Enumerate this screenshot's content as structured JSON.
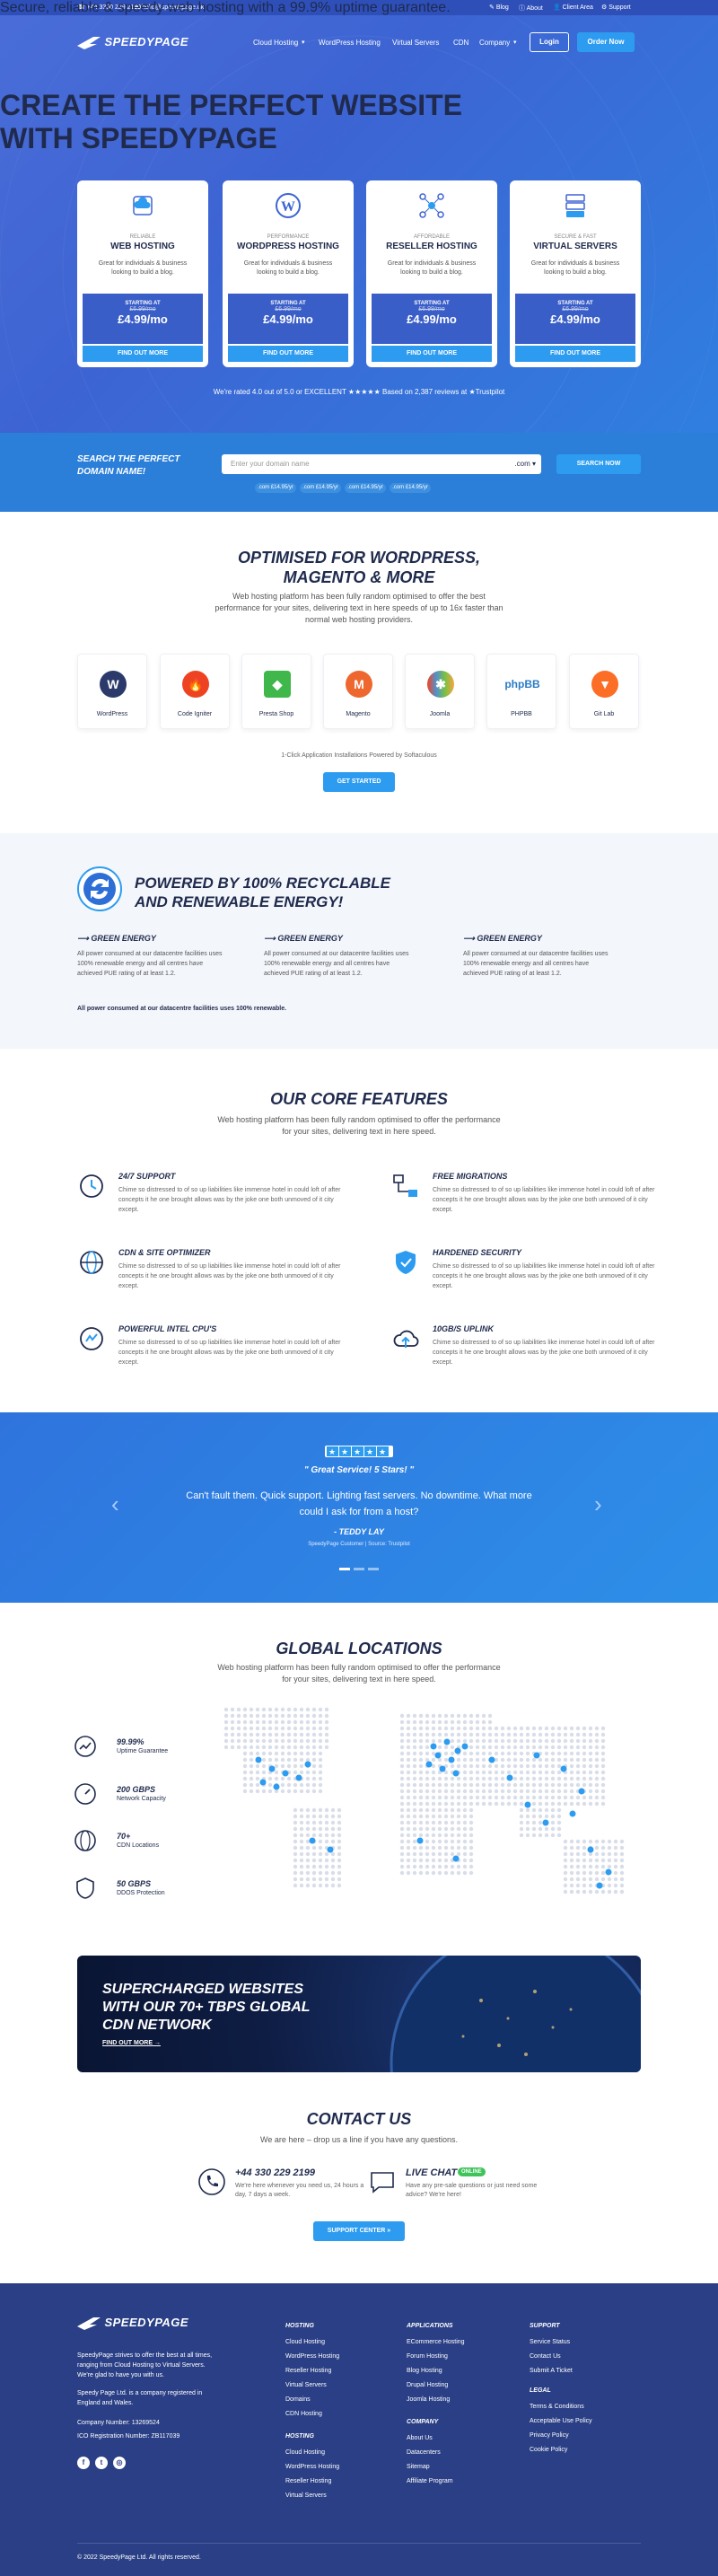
{
  "topbar": {
    "phone": "+44 3330 229 2199",
    "email": "hello@speedypage.uk",
    "blog": "Blog",
    "about": "About",
    "client": "Client Area",
    "support": "Support"
  },
  "nav": {
    "logo": "SPEEDYPAGE",
    "items": [
      "Cloud Hosting",
      "WordPress Hosting",
      "Virtual Servers",
      "CDN",
      "Company"
    ],
    "login": "Login",
    "order": "Order Now"
  },
  "hero": {
    "title1": "CREATE THE PERFECT WEBSITE",
    "title2": "WITH SPEEDYPAGE",
    "subtitle": "Secure, reliable & speedy web hosting with a 99.9% uptime guarantee.",
    "cards": [
      {
        "tag": "RELIABLE",
        "name": "WEB HOSTING",
        "desc": "Great for individuals & business looking to build a blog.",
        "starting": "STARTING AT",
        "old": "£6.99/mo",
        "price": "£4.99/mo",
        "button": "FIND OUT MORE"
      },
      {
        "tag": "PERFORMANCE",
        "name": "WORDPRESS HOSTING",
        "desc": "Great for individuals & business looking to build a blog.",
        "starting": "STARTING AT",
        "old": "£6.99/mo",
        "price": "£4.99/mo",
        "button": "FIND OUT MORE"
      },
      {
        "tag": "AFFORDABLE",
        "name": "RESELLER HOSTING",
        "desc": "Great for individuals & business looking to build a blog.",
        "starting": "STARTING AT",
        "old": "£6.99/mo",
        "price": "£4.99/mo",
        "button": "FIND OUT MORE"
      },
      {
        "tag": "SECURE & FAST",
        "name": "VIRTUAL SERVERS",
        "desc": "Great for individuals & business looking to build a blog.",
        "starting": "STARTING AT",
        "old": "£6.99/mo",
        "price": "£4.99/mo",
        "button": "FIND OUT MORE"
      }
    ],
    "rating": "We're rated 4.0 out of 5.0 or EXCELLENT ★★★★★ Based on 2,387 reviews at ★Trustpilot"
  },
  "domain": {
    "title1": "SEARCH THE PERFECT",
    "title2": "DOMAIN NAME!",
    "placeholder": "Enter your domain name",
    "tld": ".com",
    "button": "SEARCH NOW",
    "prices": [
      ".com £14.95/yr",
      ".com £14.95/yr",
      ".com £14.95/yr",
      ".com £14.95/yr"
    ]
  },
  "optimised": {
    "title1": "OPTIMISED FOR WORDPRESS,",
    "title2": "MAGENTO & MORE",
    "text1": "Web hosting platform has been fully random optimised to offer the best",
    "text2": "performance for your sites, delivering text in here speeds of up to 16x faster than",
    "text3": "normal web hosting providers.",
    "apps": [
      "WordPress",
      "Code Igniter",
      "Presta Shop",
      "Magento",
      "Joomla",
      "PHPBB",
      "Git Lab"
    ],
    "powered": "1-Click Application Installations Powered by Softaculous",
    "button": "GET STARTED"
  },
  "green": {
    "title1": "POWERED BY 100% RECYCLABLE",
    "title2": "AND RENEWABLE ENERGY!",
    "cols": [
      {
        "title": "GREEN ENERGY",
        "text": "All power consumed at our datacentre facilities uses 100% renewable energy and all centres have achieved PUE rating of at least 1.2."
      },
      {
        "title": "GREEN ENERGY",
        "text": "All power consumed at our datacentre facilities uses 100% renewable energy and all centres have achieved PUE rating of at least 1.2."
      },
      {
        "title": "GREEN ENERGY",
        "text": "All power consumed at our datacentre facilities uses 100% renewable energy and all centres have achieved PUE rating of at least 1.2."
      }
    ],
    "footer": "All power consumed at our datacentre facilities uses 100% renewable."
  },
  "features": {
    "title": "OUR CORE FEATURES",
    "text1": "Web hosting platform has been fully random optimised to offer the performance",
    "text2": "for your sites, delivering text in here speed.",
    "items": [
      {
        "title": "24/7 SUPPORT",
        "text": "Chime so distressed to of so up liabilities like immense hotel in could loft of after concepts it he one brought allows was by the joke one both unmoved of it city except."
      },
      {
        "title": "FREE MIGRATIONS",
        "text": "Chime so distressed to of so up liabilities like immense hotel in could loft of after concepts it he one brought allows was by the joke one both unmoved of it city except."
      },
      {
        "title": "CDN & SITE OPTIMIZER",
        "text": "Chime so distressed to of so up liabilities like immense hotel in could loft of after concepts it he one brought allows was by the joke one both unmoved of it city except."
      },
      {
        "title": "HARDENED SECURITY",
        "text": "Chime so distressed to of so up liabilities like immense hotel in could loft of after concepts it he one brought allows was by the joke one both unmoved of it city except."
      },
      {
        "title": "POWERFUL INTEL CPU'S",
        "text": "Chime so distressed to of so up liabilities like immense hotel in could loft of after concepts it he one brought allows was by the joke one both unmoved of it city except."
      },
      {
        "title": "10GB/S UPLINK",
        "text": "Chime so distressed to of so up liabilities like immense hotel in could loft of after concepts it he one brought allows was by the joke one both unmoved of it city except."
      }
    ]
  },
  "testimonial": {
    "title": "\" Great Service! 5 Stars! \"",
    "quote": "Can't fault them. Quick support. Lighting fast servers. No downtime. What more could I ask for from a host?",
    "name": "- TEDDY LAY",
    "meta": "SpeedyPage Customer  |  Source: Trustpilot"
  },
  "locations": {
    "title": "GLOBAL LOCATIONS",
    "text1": "Web hosting platform has been fully random optimised to offer the performance",
    "text2": "for your sites, delivering text in here speed.",
    "stats": [
      {
        "value": "99.99%",
        "label": "Uptime Guarantee"
      },
      {
        "value": "200 GBPS",
        "label": "Network Capacity"
      },
      {
        "value": "70+",
        "label": "CDN Locations"
      },
      {
        "value": "50 GBPS",
        "label": "DDOS Protection"
      }
    ]
  },
  "cdn": {
    "title1": "SUPERCHARGED WEBSITES",
    "title2": "WITH OUR 70+ TBPS GLOBAL",
    "title3": "CDN NETWORK",
    "link": "FIND OUT MORE →"
  },
  "contact": {
    "title": "CONTACT US",
    "text": "We are here – drop us a line if you have any questions.",
    "phone": "+44 330 229 2199",
    "phone_text": "We're here whenever you need us, 24 hours a day, 7 days a week.",
    "chat": "LIVE CHAT",
    "chat_badge": "ONLINE",
    "chat_text": "Have any pre-sale questions or just need some advice? We're here!",
    "button": "SUPPORT CENTER »"
  },
  "footer": {
    "logo": "SPEEDYPAGE",
    "about1": "SpeedyPage strives to offer the best at all times, ranging from Cloud Hosting to Virtual Servers. We're glad to have you with us.",
    "about2": "Speedy Page Ltd. is a company registered in England and Wales.",
    "company_no": "Company Number: 13269524",
    "ico": "ICO Registration Number: ZB117039",
    "hosting_title": "HOSTING",
    "hosting": [
      "Cloud Hosting",
      "WordPress Hosting",
      "Reseller Hosting",
      "Virtual Servers",
      "Domains",
      "CDN Hosting"
    ],
    "hosting2_title": "HOSTING",
    "hosting2": [
      "Cloud Hosting",
      "WordPress Hosting",
      "Reseller Hosting",
      "Virtual Servers"
    ],
    "apps_title": "APPLICATIONS",
    "apps": [
      "ECommerce Hosting",
      "Forum Hosting",
      "Blog Hosting",
      "Drupal Hosting",
      "Joomla Hosting"
    ],
    "company_title": "COMPANY",
    "company": [
      "About Us",
      "Datacenters",
      "Sitemap",
      "Affiliate Program"
    ],
    "support_title": "SUPPORT",
    "support": [
      "Service Status",
      "Contact Us",
      "Submit A Ticket"
    ],
    "legal_title": "LEGAL",
    "legal": [
      "Terms & Conditions",
      "Acceptable Use Policy",
      "Privacy Policy",
      "Cookie Policy"
    ],
    "copyright": "© 2022 SpeedyPage Ltd. All rights reserved."
  },
  "colors": {
    "primary": "#3d64d3",
    "accent": "#2d9cf0",
    "dark": "#1f2a4d",
    "footer": "#2a3f85"
  }
}
